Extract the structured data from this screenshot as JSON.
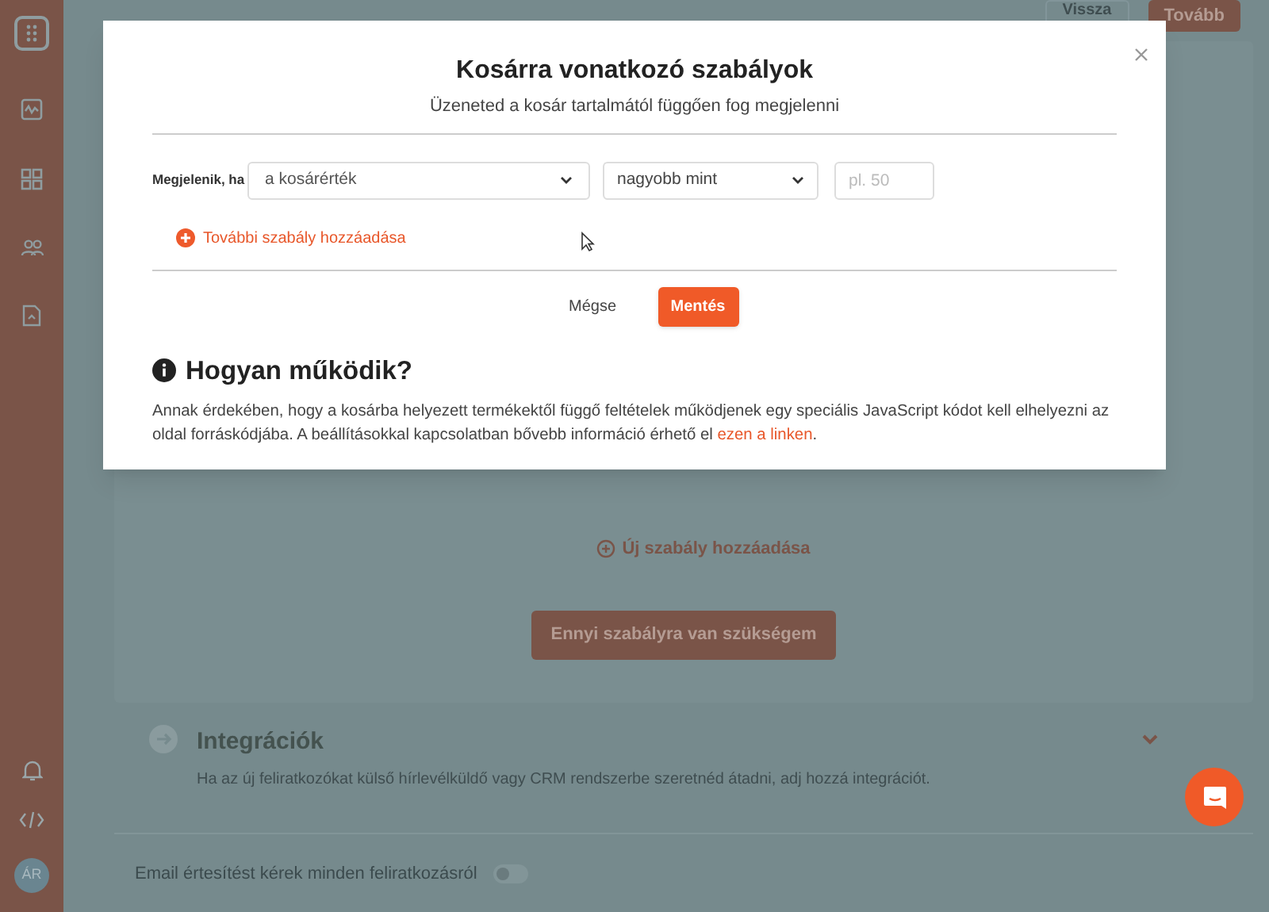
{
  "sidebar": {
    "avatar": "ÁR"
  },
  "top_bar": {
    "buttons": [
      "Vissza",
      "Tovább"
    ]
  },
  "background": {
    "add_rule_link": "Új szabály hozzáadása",
    "rules_button": "Ennyi szabályra van szükségem",
    "integrations": {
      "title": "Integrációk",
      "description": "Ha az új feliratkozókat külső hírlevélküldő vagy CRM rendszerbe szeretnéd átadni, adj hozzá integrációt."
    },
    "email_toggle": {
      "label": "Email értesítést kérek minden feliratkozásról",
      "on": false
    }
  },
  "modal": {
    "title": "Kosárra vonatkozó szabályok",
    "subtitle": "Üzeneted a kosár tartalmától függően fog megjelenni",
    "condition": {
      "label": "Megjelenik, ha",
      "field": "a kosárérték",
      "operator": "nagyobb mint",
      "value_placeholder": "pl. 50"
    },
    "add_rule": "További szabály hozzáadása",
    "cancel": "Mégse",
    "save": "Mentés",
    "help": {
      "title": "Hogyan működik?",
      "text": "Annak érdekében, hogy a kosárba helyezett termékektől függő feltételek működjenek egy speciális JavaScript kódot kell elhelyezni az oldal forráskódjába. A beállításokkal kapcsolatban bővebb információ érhető el ",
      "link": "ezen a linken",
      "text_after": "."
    }
  }
}
